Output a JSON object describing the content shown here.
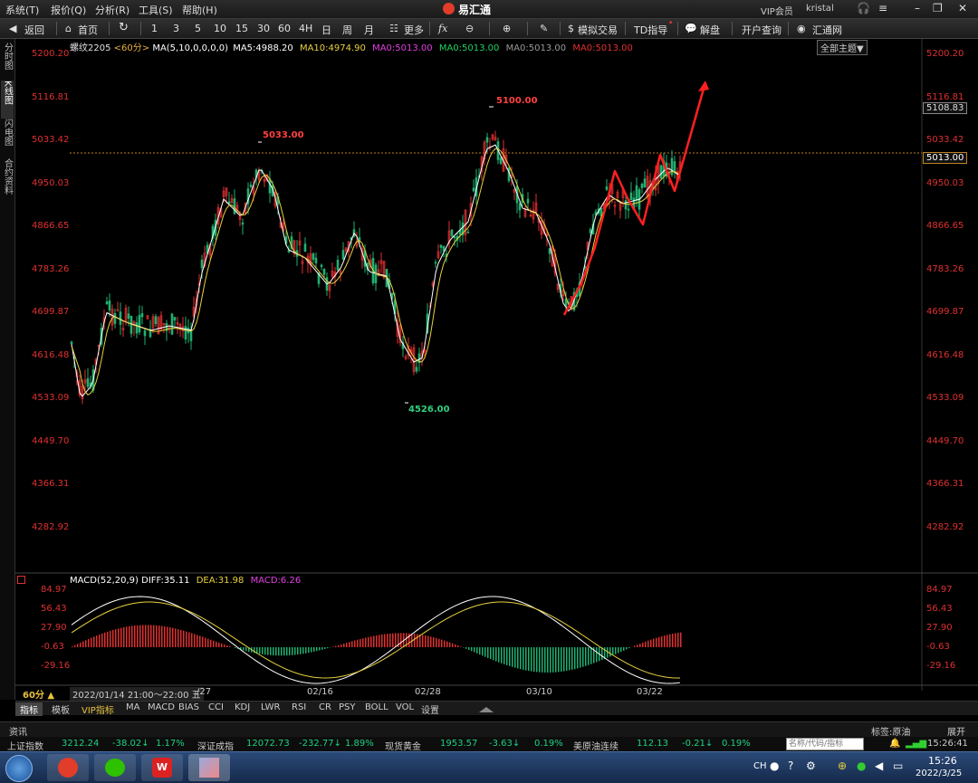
{
  "menu": {
    "items": [
      "系统(T)",
      "报价(Q)",
      "分析(R)",
      "工具(S)",
      "帮助(H)"
    ],
    "app_title": "易汇通",
    "vip": "VIP会员",
    "user": "kristal"
  },
  "toolbar": {
    "back": "返回",
    "home": "首页",
    "periods": [
      "1",
      "3",
      "5",
      "10",
      "15",
      "30",
      "60",
      "4H",
      "日",
      "周",
      "月"
    ],
    "more": "更多",
    "sim_trade": "模拟交易",
    "td_guide": "TD指导",
    "market_review": "解盘",
    "open_account": "开户查询",
    "huitong_net": "汇通网"
  },
  "sidebar": {
    "tabs": [
      "分时图",
      "K线图",
      "闪电图",
      "合约资料"
    ],
    "active": "K线图"
  },
  "chart_header": {
    "symbol": "螺纹2205",
    "period": "<60分>",
    "ma_param": "MA(5,10,0,0,0,0)",
    "ma5": "MA5:4988.20",
    "ma10": "MA10:4974.90",
    "ma0a": "MA0:5013.00",
    "ma0b": "MA0:5013.00",
    "ma0c": "MA0:5013.00",
    "ma0d": "MA0:5013.00",
    "theme_button": "全部主题▼"
  },
  "price_axis": {
    "labels": [
      "5200.20",
      "5116.81",
      "5033.42",
      "4950.03",
      "4866.65",
      "4783.26",
      "4699.87",
      "4616.48",
      "4533.09",
      "4449.70",
      "4366.31",
      "4282.92"
    ],
    "current_price": "5013.00",
    "cursor_price": "5108.83"
  },
  "annotations": {
    "high1": "5033.00",
    "high2": "5100.00",
    "low1": "4526.00"
  },
  "macd_header": {
    "name": "MACD(52,20,9)",
    "diff": "DIFF:35.11",
    "dea": "DEA:31.98",
    "macd": "MACD:6.26"
  },
  "macd_axis": {
    "labels": [
      "84.97",
      "56.43",
      "27.90",
      "-0.63",
      "-29.16"
    ]
  },
  "time_axis": {
    "period_button": "60分 ▲",
    "cursor_time": "2022/01/14 21:00～22:00 五",
    "partial": "/27",
    "dates": [
      "02/16",
      "02/28",
      "03/10",
      "03/22"
    ]
  },
  "indicator_tabs": [
    "指标",
    "模板",
    "VIP指标",
    "MA",
    "MACD",
    "BIAS",
    "CCI",
    "KDJ",
    "LWR",
    "RSI",
    "CR",
    "PSY",
    "BOLL",
    "VOL",
    "设置"
  ],
  "info_bar": {
    "left": "资讯",
    "tag": "标签:原油",
    "expand": "展开"
  },
  "ticker": [
    {
      "name": "上证指数",
      "value": "3212.24",
      "change": "-38.02↓",
      "pct": "1.17%"
    },
    {
      "name": "深证成指",
      "value": "12072.73",
      "change": "-232.77↓",
      "pct": "1.89%"
    },
    {
      "name": "现货黄金",
      "value": "1953.57",
      "change": "-3.63↓",
      "pct": "0.19%"
    },
    {
      "name": "美原油连续",
      "value": "112.13",
      "change": "-0.21↓",
      "pct": "0.19%"
    }
  ],
  "search_placeholder": "名称/代码/指标",
  "clock": {
    "time_small": "15:26:41",
    "time": "15:26",
    "date": "2022/3/25"
  },
  "taskbar_lang": "CH",
  "colors": {
    "up": "#e03030",
    "down": "#20b070",
    "ma5": "#ffffff",
    "ma10": "#e8d040",
    "accent_red": "#ff2020"
  }
}
